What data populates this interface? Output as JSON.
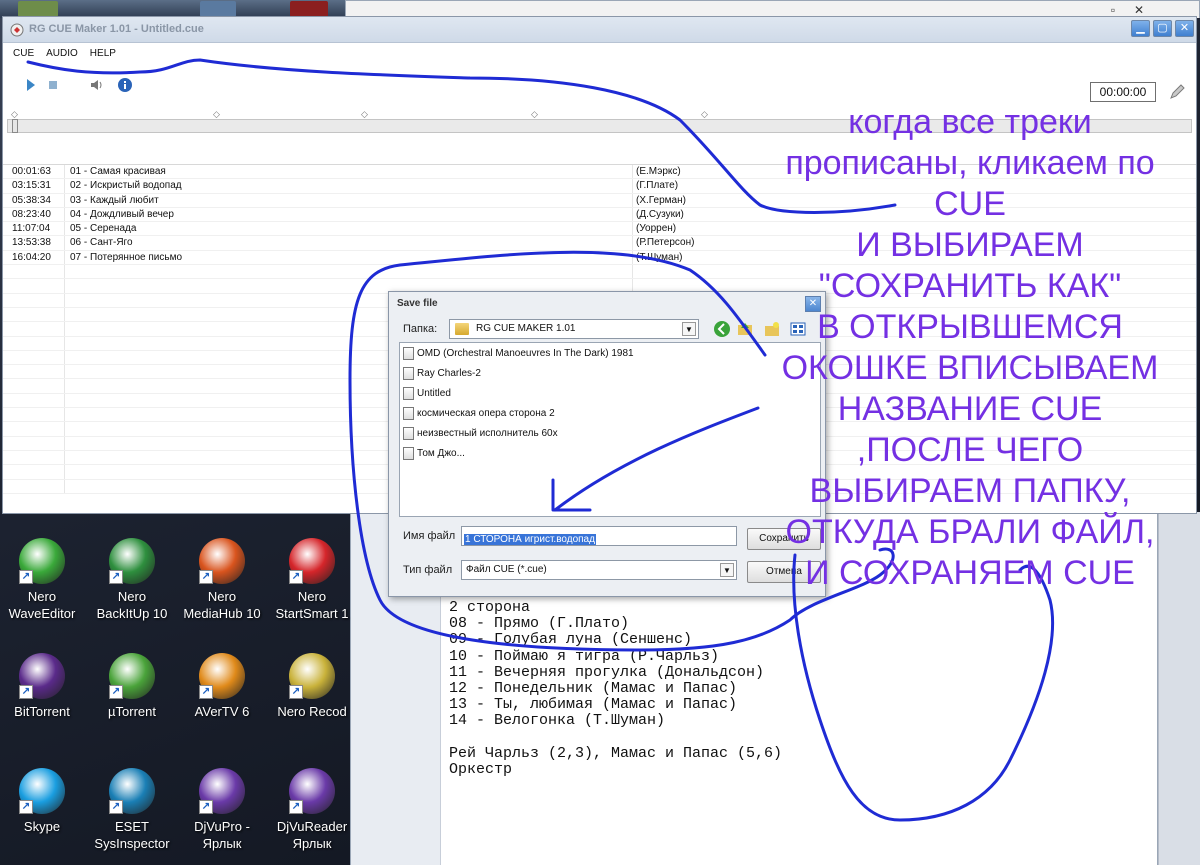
{
  "colors": {
    "annotation_text": "#7430e3",
    "annotation_stroke": "#1f2bd4",
    "title_text": "#8a96a6",
    "selection": "#3874d8"
  },
  "app": {
    "title": "RG CUE Maker 1.01 - Untitled.cue",
    "menu": [
      "CUE",
      "AUDIO",
      "HELP"
    ],
    "time": "00:00:00",
    "tracks": [
      {
        "time": "00:01:63",
        "title": "01 - Самая красивая",
        "performer": "(Е.Мэркс)"
      },
      {
        "time": "03:15:31",
        "title": "02 - Искристый водопад",
        "performer": "(Г.Плате)"
      },
      {
        "time": "05:38:34",
        "title": "03 - Каждый любит",
        "performer": "(Х.Герман)"
      },
      {
        "time": "08:23:40",
        "title": "04 - Дождливый вечер",
        "performer": "(Д.Сузуки)"
      },
      {
        "time": "11:07:04",
        "title": "05 - Серенада",
        "performer": "(Уоррен)"
      },
      {
        "time": "13:53:38",
        "title": "06 - Сант-Яго",
        "performer": "(Р.Петерсон)"
      },
      {
        "time": "16:04:20",
        "title": "07 - Потерянное письмо",
        "performer": "(Т.Шуман)"
      }
    ]
  },
  "dialog": {
    "title": "Save file",
    "folder_label": "Папка:",
    "folder_value": "RG CUE MAKER 1.01",
    "files": [
      "OMD (Orchestral Manoeuvres In The Dark) 1981",
      "Ray Charles-2",
      "Untitled",
      "космическая опера сторона 2",
      "неизвестный исполнитель 60х",
      "Том Джо..."
    ],
    "filename_label": "Имя файл",
    "filename_value": "1 СТОРОНА игрист.водопад",
    "filetype_label": "Тип файл",
    "filetype_value": "Файл CUE (*.cue)",
    "save_button": "Сохранить",
    "cancel_button": "Отмена"
  },
  "editor": {
    "lines": [
      "2 сторона",
      "08 - Прямо (Г.Плато)",
      "09 - Голубая луна (Сеншенс)",
      "10 - Поймаю я тигра (Р.Чарльз)",
      "11 - Вечерняя прогулка (Дональдсон)",
      "12 - Понедельник (Мамас и Папас)",
      "13 - Ты, любимая (Мамас и Папас)",
      "14 - Велогонка (Т.Шуман)",
      "",
      "Рей Чарльз (2,3), Мамас и Папас (5,6)",
      "Оркестр"
    ]
  },
  "desktop_icons": [
    {
      "label1": "Nero",
      "label2": "WaveEditor",
      "icon": "nero-waveeditor-icon",
      "color": "#3aa93a"
    },
    {
      "label1": "Nero",
      "label2": "BackItUp 10",
      "icon": "nero-backitup-icon",
      "color": "#2e8f3e"
    },
    {
      "label1": "Nero",
      "label2": "MediaHub 10",
      "icon": "nero-mediahub-icon",
      "color": "#d9541e"
    },
    {
      "label1": "Nero",
      "label2": "StartSmart 1",
      "icon": "nero-startsmart-icon",
      "color": "#d5252a"
    },
    {
      "label1": "BitTorrent",
      "label2": "",
      "icon": "bittorrent-icon",
      "color": "#5a2a8a"
    },
    {
      "label1": "µTorrent",
      "label2": "",
      "icon": "utorrent-icon",
      "color": "#4aa33a"
    },
    {
      "label1": "AVerTV 6",
      "label2": "",
      "icon": "avertv-icon",
      "color": "#e08a1a"
    },
    {
      "label1": "Nero Recod",
      "label2": "",
      "icon": "nero-recode-icon",
      "color": "#c9b23a"
    },
    {
      "label1": "Skype",
      "label2": "",
      "icon": "skype-icon",
      "color": "#1a9ee0"
    },
    {
      "label1": "ESET",
      "label2": "SysInspector",
      "icon": "eset-sysinspector-icon",
      "color": "#1a7fb5"
    },
    {
      "label1": "DjVuPro -",
      "label2": "Ярлык",
      "icon": "djvupro-icon",
      "color": "#6a3aa8"
    },
    {
      "label1": "DjVuReader",
      "label2": "Ярлык",
      "icon": "djvureader-icon",
      "color": "#6a3aa8"
    }
  ],
  "annotation": {
    "lines": [
      "когда все треки",
      "прописаны, кликаем по",
      "CUE",
      "И ВЫБИРАЕМ",
      "\"СОХРАНИТЬ КАК\"",
      "В ОТКРЫВШЕМСЯ",
      "ОКОШКЕ ВПИСЫВАЕМ",
      "НАЗВАНИЕ CUE",
      ",ПОСЛЕ ЧЕГО",
      "ВЫБИРАЕМ ПАПКУ,",
      "ОТКУДА БРАЛИ ФАЙЛ,",
      "И СОХРАНЯЕМ CUE"
    ]
  }
}
